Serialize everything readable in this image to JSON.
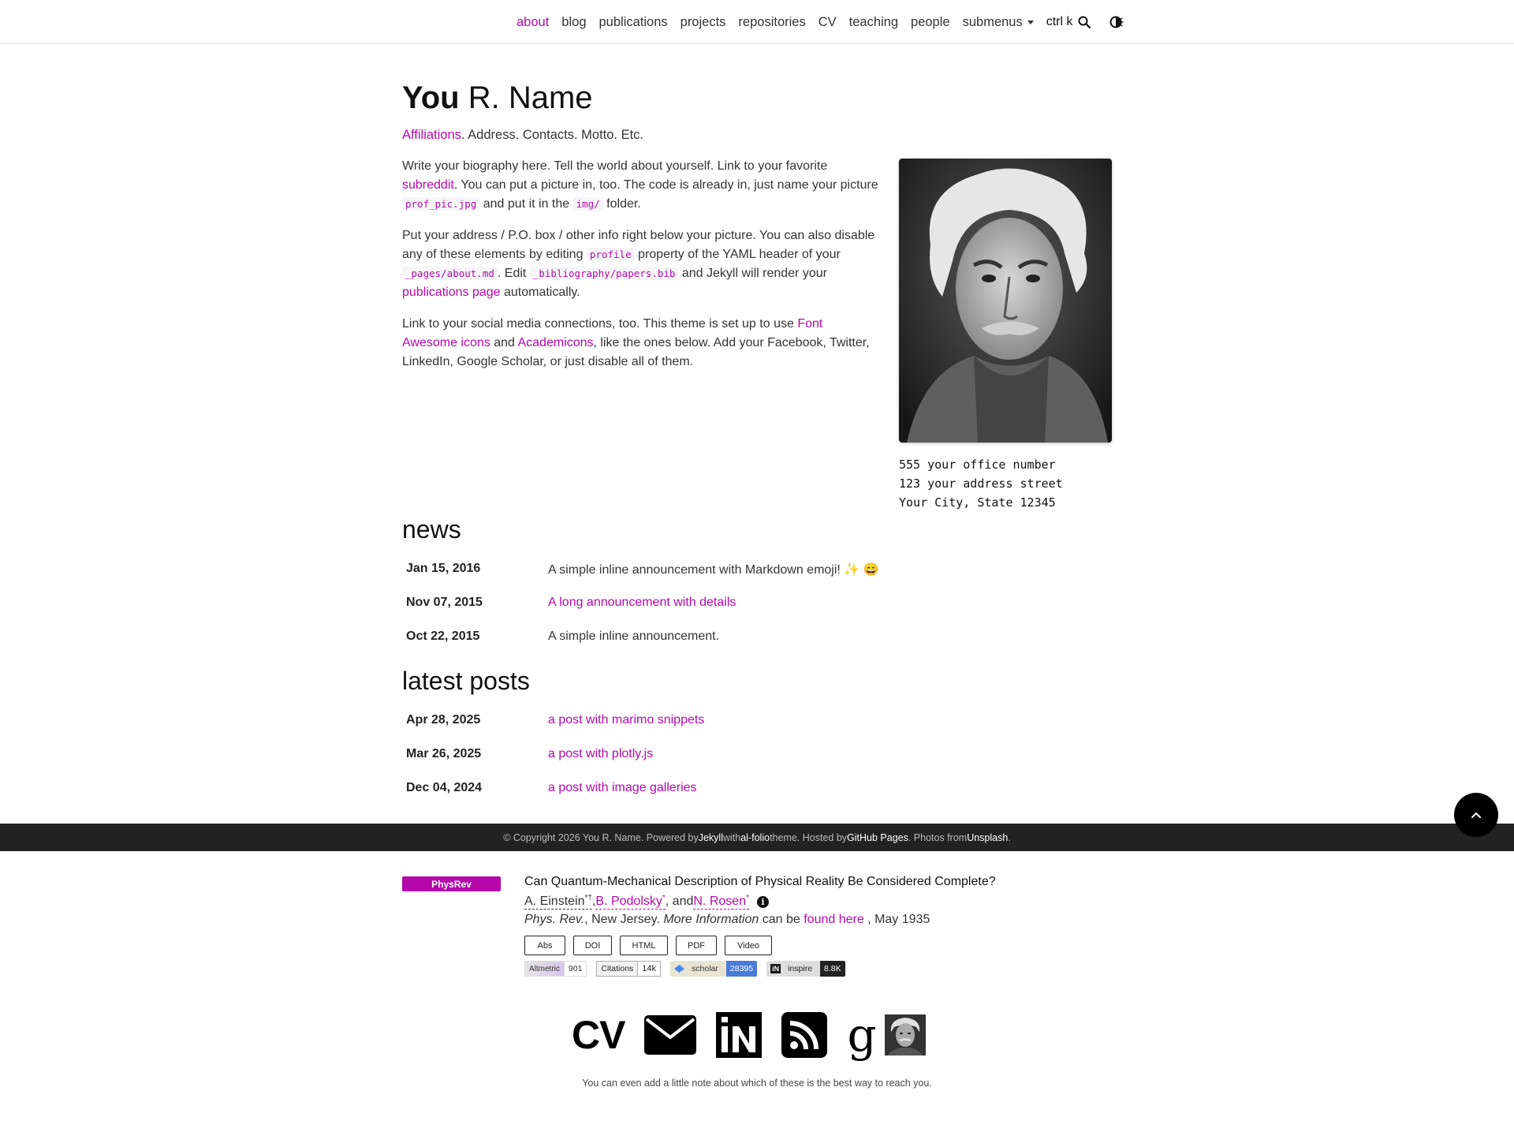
{
  "nav": {
    "items": [
      {
        "label": "about",
        "active": true
      },
      {
        "label": "blog"
      },
      {
        "label": "publications"
      },
      {
        "label": "projects"
      },
      {
        "label": "repositories"
      },
      {
        "label": "CV"
      },
      {
        "label": "teaching"
      },
      {
        "label": "people"
      }
    ],
    "submenus": "submenus",
    "search_label": "ctrl k",
    "search_icon": "search-icon",
    "theme_icon": "half-circle-theme-icon"
  },
  "header": {
    "first_name": "You",
    "rest_name": "R. Name",
    "affiliations_link": "Affiliations",
    "description_rest": ". Address. Contacts. Motto. Etc."
  },
  "bio": {
    "p1_a": "Write your biography here. Tell the world about yourself. Link to your favorite ",
    "p1_link": "subreddit",
    "p1_b": ". You can put a picture in, too. The code is already in, just name your picture ",
    "p1_code1": "prof_pic.jpg",
    "p1_c": " and put it in the ",
    "p1_code2": "img/",
    "p1_d": " folder.",
    "p2_a": "Put your address / P.O. box / other info right below your picture. You can also disable any of these elements by editing ",
    "p2_code1": "profile",
    "p2_b": " property of the YAML header of your ",
    "p2_code2": "_pages/about.md",
    "p2_c": ". Edit ",
    "p2_code3": "_bibliography/papers.bib",
    "p2_d": " and Jekyll will render your ",
    "p2_link": "publications page",
    "p2_e": " automatically.",
    "p3_a": "Link to your social media connections, too. This theme is set up to use ",
    "p3_link1": "Font Awesome icons",
    "p3_b": " and ",
    "p3_link2": "Academicons",
    "p3_c": ", like the ones below. Add your Facebook, Twitter, LinkedIn, Google Scholar, or just disable all of them."
  },
  "address": {
    "line1": "555 your office number",
    "line2": "123 your address street",
    "line3": "Your City, State 12345"
  },
  "news": {
    "title": "news",
    "items": [
      {
        "date": "Jan 15, 2016",
        "text": "A simple inline announcement with Markdown emoji! ✨ 😄",
        "link": false
      },
      {
        "date": "Nov 07, 2015",
        "text": "A long announcement with details",
        "link": true
      },
      {
        "date": "Oct 22, 2015",
        "text": "A simple inline announcement.",
        "link": false
      }
    ]
  },
  "posts": {
    "title": "latest posts",
    "items": [
      {
        "date": "Apr 28, 2025",
        "text": "a post with marimo snippets"
      },
      {
        "date": "Mar 26, 2025",
        "text": "a post with plotly.js"
      },
      {
        "date": "Dec 04, 2024",
        "text": "a post with image galleries"
      }
    ]
  },
  "footer": {
    "a": "© Copyright 2026 You R. Name. Powered by ",
    "jekyll": "Jekyll",
    "b": " with ",
    "alfolio": "al-folio",
    "c": " theme. Hosted by ",
    "ghpages": "GitHub Pages",
    "d": ". Photos from ",
    "unsplash": "Unsplash",
    "e": "."
  },
  "publication": {
    "badge": "PhysRev",
    "title": "Can Quantum-Mechanical Description of Physical Reality Be Considered Complete?",
    "author1": "A. Einstein",
    "author1_sup": "*†",
    "sep1": ", ",
    "author2": "B. Podolsky",
    "author2_sup": "*",
    "sep2": ", and ",
    "author3": "N. Rosen",
    "author3_sup": "*",
    "info": "i",
    "venue_journal": "Phys. Rev.",
    "venue_place": ", New Jersey. ",
    "venue_more": "More Information",
    "venue_can": " can be ",
    "venue_link": "found here",
    "venue_date": " , May 1935",
    "buttons": [
      "Abs",
      "DOI",
      "HTML",
      "PDF",
      "Video"
    ],
    "metrics": {
      "altmetric_label": "Altmetric",
      "altmetric_value": "901",
      "citations_label": "Citations",
      "citations_value": "14k",
      "scholar_label": "scholar",
      "scholar_value": "28395",
      "inspire_label": "inspire",
      "inspire_value": "8.8K"
    }
  },
  "social": {
    "cv": "CV",
    "icons": [
      "cv-icon",
      "envelope-icon",
      "inspire-icon",
      "rss-icon",
      "google-scholar-icon",
      "avatar"
    ],
    "note": "You can even add a little note about which of these is the best way to reach you."
  },
  "colors": {
    "accent": "#b509ac",
    "footer_bg": "#222222"
  }
}
